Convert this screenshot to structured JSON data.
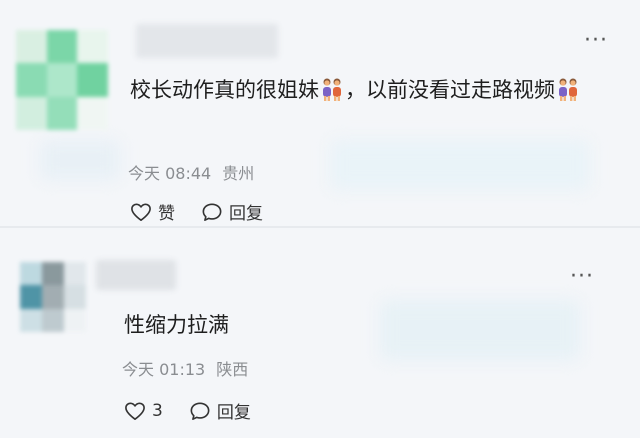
{
  "comments": [
    {
      "text_main": "校长动作真的很姐妹",
      "text_tail": "，以前没看过走路视频",
      "emoji_icon": "two-women-emoji",
      "time": "今天 08:44",
      "location": "贵州",
      "like_label": "赞",
      "reply_label": "回复",
      "more_label": "···"
    },
    {
      "text_main": "性缩力拉满",
      "time": "今天 01:13",
      "location": "陕西",
      "like_count": "3",
      "reply_label": "回复",
      "more_label": "···"
    }
  ],
  "colors": {
    "avatar1": [
      "#d7efe0",
      "#6fd3a0",
      "#e7f5ec",
      "#7fd9ac",
      "#a6e6c6",
      "#62cf97",
      "#cfeedd",
      "#8adcb3",
      "#f0f7f3"
    ],
    "avatar2": [
      "#b8d6de",
      "#7f8f94",
      "#dfe6ea",
      "#3e8a9e",
      "#9aa6ab",
      "#d3dde1",
      "#c9dde3",
      "#b9c6cb",
      "#eef2f4"
    ]
  }
}
